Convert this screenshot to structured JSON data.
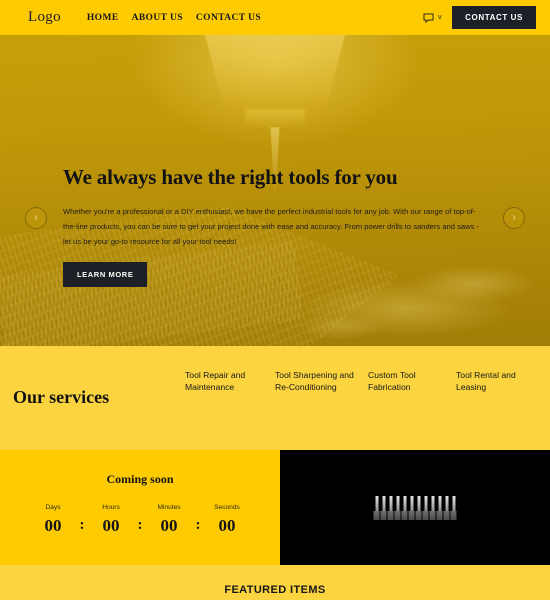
{
  "header": {
    "logo": "Logo",
    "nav": [
      {
        "label": "HOME"
      },
      {
        "label": "ABOUT US"
      },
      {
        "label": "CONTACT US"
      }
    ],
    "lang_icon": "chat-bubble-icon",
    "chevron": "˅",
    "contact_button": "CONTACT US"
  },
  "hero": {
    "title": "We always have the right tools for you",
    "paragraph": "Whether you're a professional or a DIY enthusiast, we have the perfect industrial tools for any job. With our range of top-of-the-line products, you can be sure to get your project done with ease and accuracy. From power drills to sanders and saws - let us be your go-to resource for all your tool needs!",
    "cta": "LEARN MORE",
    "prev_arrow": "‹",
    "next_arrow": "›",
    "slides": [
      {
        "active": true
      },
      {
        "active": false
      },
      {
        "active": false
      }
    ]
  },
  "services": {
    "title": "Our services",
    "items": [
      {
        "label": "Tool Repair and Maintenance"
      },
      {
        "label": "Tool Sharpening and Re-Conditioning"
      },
      {
        "label": "Custom Tool Fabrication"
      },
      {
        "label": "Tool Rental and Leasing"
      }
    ]
  },
  "countdown": {
    "heading": "Coming soon",
    "separator": ":",
    "units": [
      {
        "label": "Days",
        "value": "00"
      },
      {
        "label": "Hours",
        "value": "00"
      },
      {
        "label": "Minutes",
        "value": "00"
      },
      {
        "label": "Seconds",
        "value": "00"
      }
    ]
  },
  "promo": {
    "image_alt": "screwdriver-bits-set"
  },
  "featured": {
    "title": "FEATURED ITEMS"
  },
  "colors": {
    "brand_yellow": "#fecb00",
    "section_yellow": "#fbd43f",
    "dark": "#1e2027",
    "hero_overlay": "#b8920a",
    "black_panel": "#000000"
  }
}
